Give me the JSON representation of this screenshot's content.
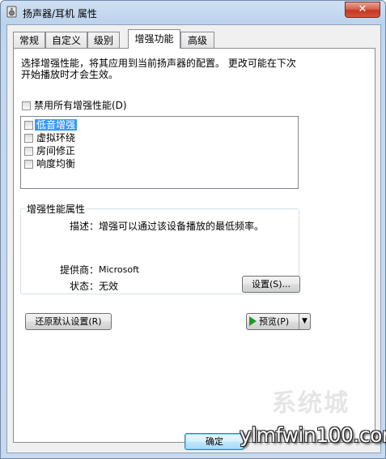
{
  "window": {
    "title": "扬声器/耳机 属性",
    "close_glyph": "✕"
  },
  "tabs": [
    {
      "label": "常规",
      "active": false
    },
    {
      "label": "自定义",
      "active": false
    },
    {
      "label": "级别",
      "active": false
    },
    {
      "label": "增强功能",
      "active": true
    },
    {
      "label": "高级",
      "active": false
    }
  ],
  "panel": {
    "description_line1": "选择增强性能，将其应用到当前扬声器的配置。  更改可能在下次",
    "description_line2": "开始播放时才会生效。",
    "disable_all_label": "禁用所有增强性能(D)",
    "disable_all_checked": false,
    "enhancements": [
      {
        "label": "低音增强",
        "checked": false,
        "selected": true
      },
      {
        "label": "虚拟环绕",
        "checked": false,
        "selected": false
      },
      {
        "label": "房间修正",
        "checked": false,
        "selected": false
      },
      {
        "label": "响度均衡",
        "checked": false,
        "selected": false
      }
    ],
    "properties": {
      "group_title": "增强性能属性",
      "description_label": "描述：",
      "description_value": "增强可以通过该设备播放的最低频率。",
      "provider_label": "提供商：",
      "provider_value": "Microsoft",
      "status_label": "状态：",
      "status_value": "无效",
      "settings_button": "设置(S)..."
    },
    "restore_defaults_button": "还原默认设置(R)",
    "preview_button": "预览(P)"
  },
  "footer": {
    "ok_button": "确定"
  },
  "watermark": {
    "text": "ylmfwin100.com",
    "logo_text": "系统城"
  },
  "colors": {
    "accent_selected": "#3399ff",
    "title_bar": "#bcd3ec",
    "close_button": "#c4381f",
    "preview_icon": "#1f9a2a"
  },
  "icons": {
    "title": "speaker-properties-icon",
    "preview": "play-icon",
    "dropdown": "chevron-down-icon"
  }
}
